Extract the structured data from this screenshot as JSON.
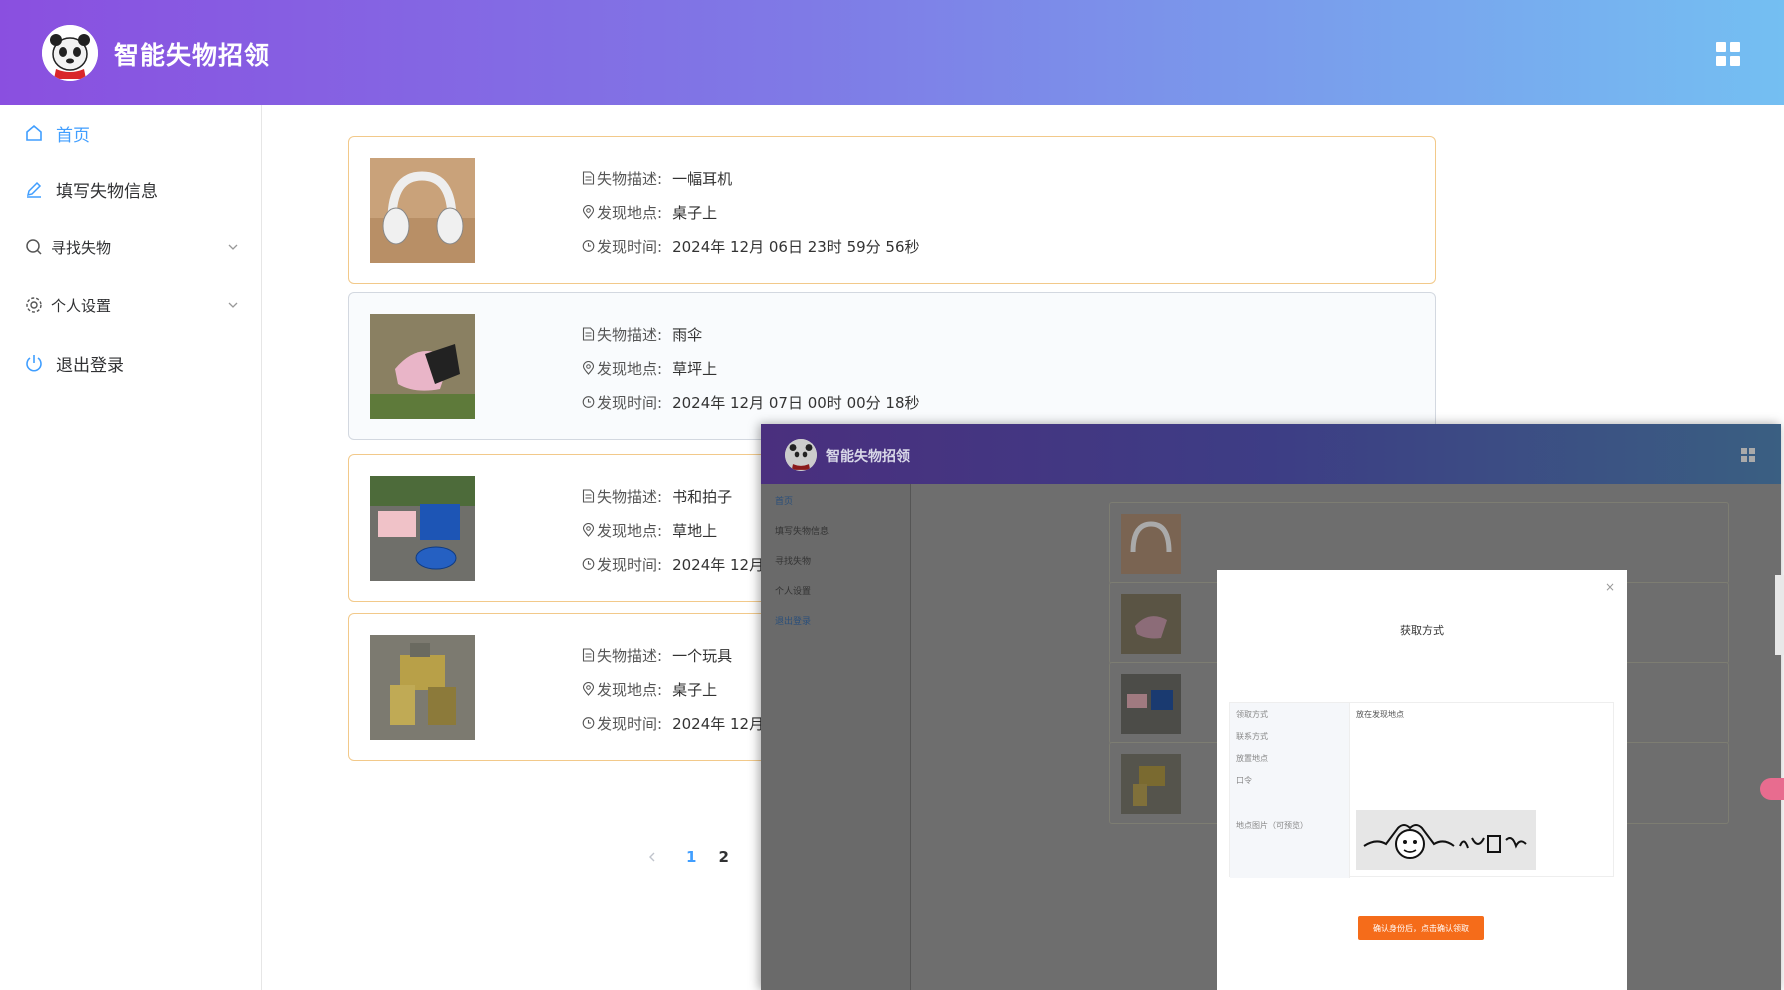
{
  "app": {
    "title": "智能失物招领"
  },
  "sidebar": {
    "items": [
      {
        "label": "首页",
        "icon": "home-icon",
        "active": true
      },
      {
        "label": "填写失物信息",
        "icon": "edit-icon"
      },
      {
        "label": "寻找失物",
        "icon": "search-icon",
        "expandable": true
      },
      {
        "label": "个人设置",
        "icon": "gear-icon",
        "expandable": true
      },
      {
        "label": "退出登录",
        "icon": "power-icon"
      }
    ]
  },
  "labels": {
    "desc": "失物描述:",
    "place": "发现地点:",
    "time": "发现时间:"
  },
  "items": [
    {
      "desc": "一幅耳机",
      "place": "桌子上",
      "time": "2024年 12月 06日 23时 59分 56秒"
    },
    {
      "desc": "雨伞",
      "place": "草坪上",
      "time": "2024年 12月 07日 00时 00分 18秒"
    },
    {
      "desc": "书和拍子",
      "place": "草地上",
      "time": "2024年 12月 ("
    },
    {
      "desc": "一个玩具",
      "place": "桌子上",
      "time": "2024年 12月 ("
    }
  ],
  "pagination": {
    "pages": [
      "1",
      "2"
    ],
    "current": "1"
  },
  "colors": {
    "accent": "#409eff",
    "card_border": "#f2c98a",
    "header_start": "#8a4fe0",
    "header_end": "#74bff2",
    "button": "#f56c1a"
  },
  "overlay": {
    "title": "智能失物招领",
    "sidebar": [
      "首页",
      "填写失物信息",
      "寻找失物",
      "个人设置",
      "退出登录"
    ],
    "modal": {
      "title": "获取方式",
      "rows": [
        {
          "label": "领取方式",
          "value": "放在发现地点"
        },
        {
          "label": "联系方式",
          "value": ""
        },
        {
          "label": "放置地点",
          "value": ""
        },
        {
          "label": "口令",
          "value": ""
        },
        {
          "label": "地点图片（可预览）",
          "value": ""
        }
      ],
      "button": "确认身份后，点击确认领取",
      "close": "×"
    }
  }
}
